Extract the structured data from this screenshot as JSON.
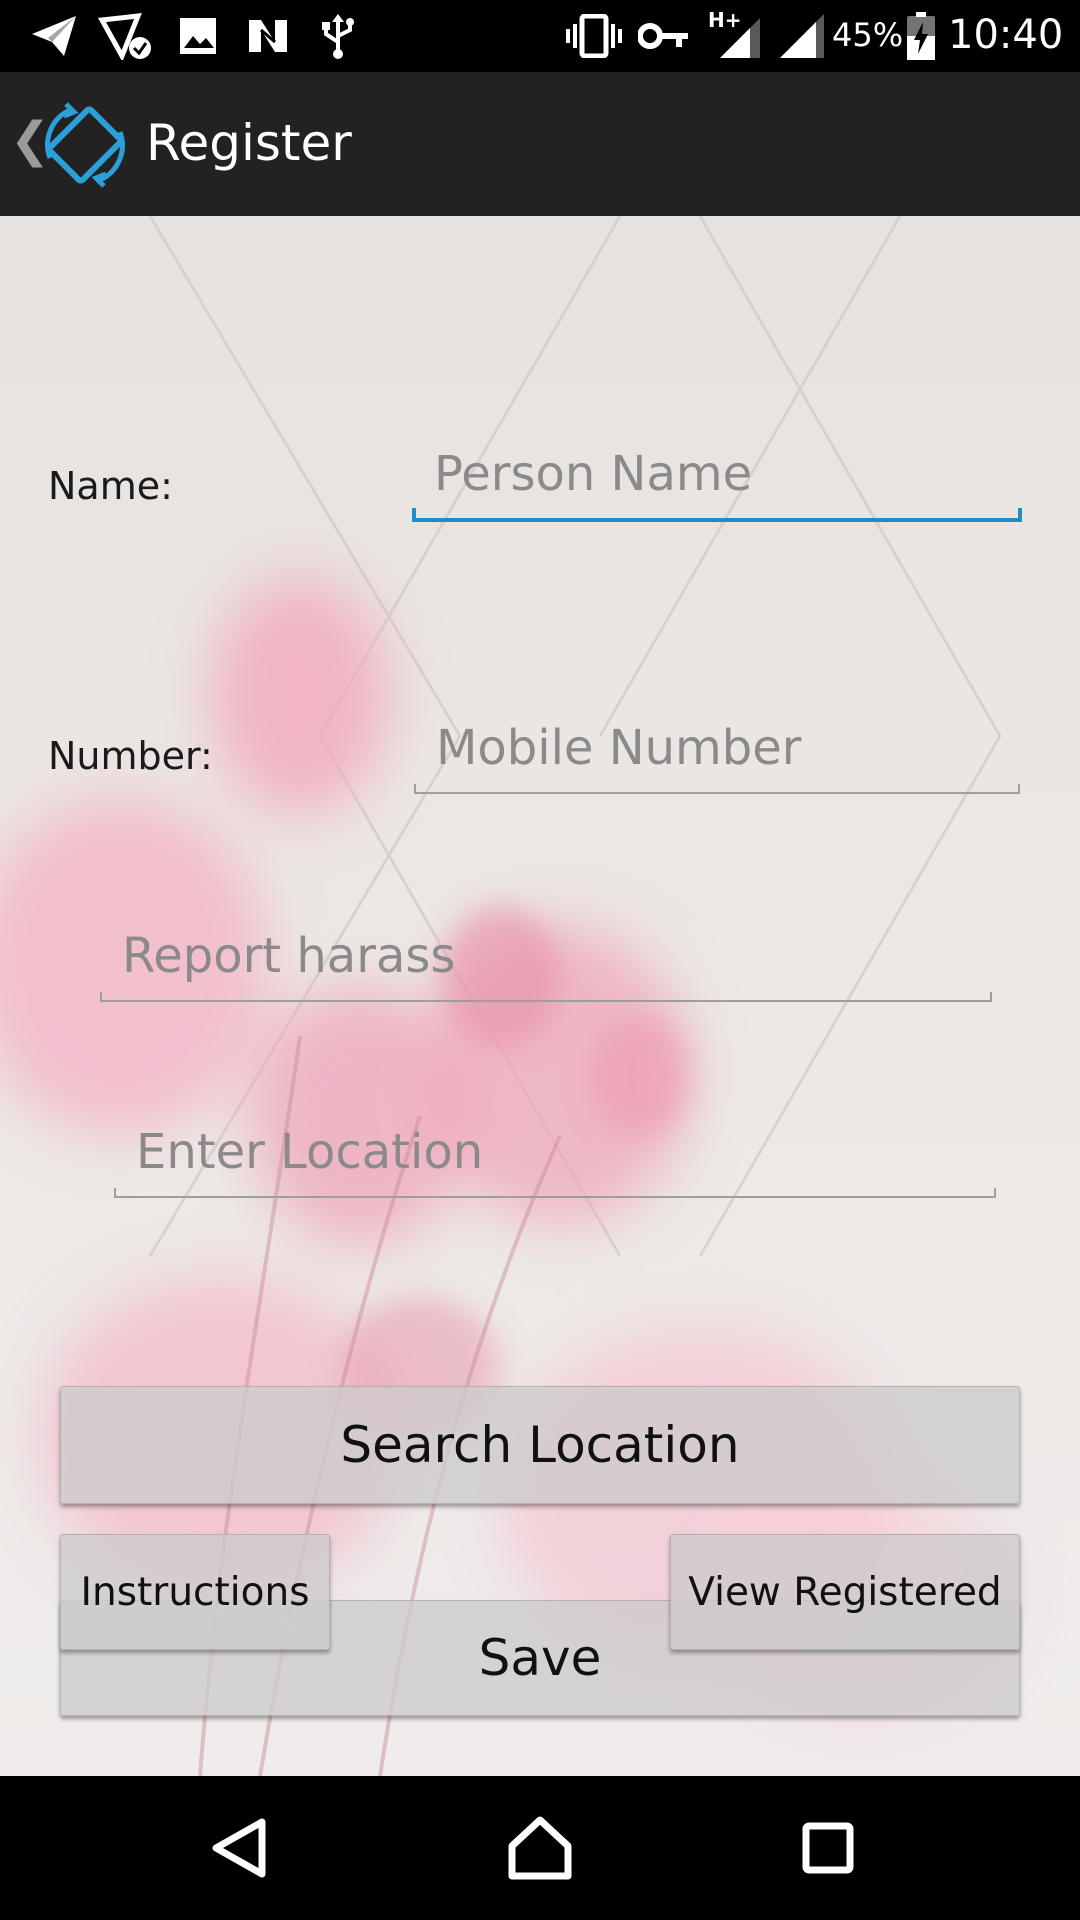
{
  "status_bar": {
    "icons": [
      "send-icon",
      "location-check-icon",
      "image-icon",
      "n-icon",
      "usb-icon",
      "vibrate-icon",
      "key-icon",
      "signal-hplus-icon",
      "signal-icon",
      "battery-charging-icon"
    ],
    "network_label": "H+",
    "battery": "45%",
    "time": "10:40"
  },
  "app_bar": {
    "title": "Register",
    "logo_icon": "screen-rotation-icon",
    "back_icon": "chevron-left-icon"
  },
  "form": {
    "name_label": "Name:",
    "name_placeholder": "Person Name",
    "number_label": "Number:",
    "number_placeholder": "Mobile Number",
    "report_placeholder": "Report harass",
    "location_placeholder": "Enter Location"
  },
  "buttons": {
    "search_location": "Search Location",
    "instructions": "Instructions",
    "view_registered": "View Registered",
    "save": "Save"
  },
  "nav_bar": {
    "back": "back-triangle-icon",
    "home": "home-icon",
    "recents": "recents-square-icon"
  },
  "colors": {
    "accent": "#1e8ec9",
    "app_bar": "#222222",
    "placeholder": "#8c8a89"
  }
}
